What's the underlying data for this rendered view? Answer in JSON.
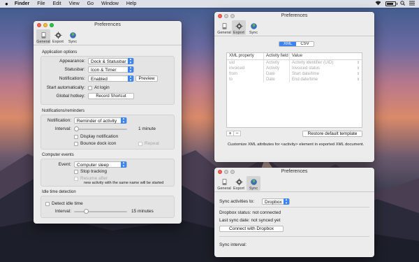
{
  "menubar": {
    "apple": "",
    "items": [
      "Finder",
      "File",
      "Edit",
      "View",
      "Go",
      "Window",
      "Help"
    ]
  },
  "win_general": {
    "title": "Preferences",
    "tabs": [
      "General",
      "Export",
      "Sync"
    ],
    "app_options_title": "Application options",
    "appearance_label": "Appearance:",
    "appearance_value": "Dock & Statusbar",
    "statusbar_label": "Statusbar:",
    "statusbar_value": "Icon & Timer",
    "notifications_label": "Notifications:",
    "notifications_value": "Enabled",
    "preview_button": "Preview",
    "start_auto_label": "Start automatically:",
    "start_auto_check": "At login",
    "hotkey_label": "Global hotkey:",
    "hotkey_button": "Record Shortcut",
    "reminders_title": "Notifications/reminders",
    "notification_label": "Notification:",
    "notification_value": "Reminder of activity",
    "interval_label": "Interval:",
    "interval_value": "1 minute",
    "display_notification": "Display notification",
    "bounce_dock": "Bounce dock icon",
    "repeat": "Repeat",
    "computer_events_title": "Computer events",
    "event_label": "Event:",
    "event_value": "Computer sleep",
    "stop_tracking": "Stop tracking",
    "resume_after": "Resume after",
    "resume_note": "new activity with the same name will be started",
    "idle_title": "Idle time detection",
    "detect_idle": "Detect idle time",
    "idle_interval_label": "Interval:",
    "idle_interval_value": "15 minutes"
  },
  "win_export": {
    "title": "Preferences",
    "tabs": [
      "General",
      "Export",
      "Sync"
    ],
    "formats": [
      "XML",
      "CSV"
    ],
    "columns": [
      "XML property",
      "Activity field",
      "Value"
    ],
    "rows": [
      {
        "prop": "uid",
        "field": "Activity",
        "value": "Activity identifier (UID)"
      },
      {
        "prop": "invoiced",
        "field": "Activity",
        "value": "Invoiced status"
      },
      {
        "prop": "from",
        "field": "Date",
        "value": "Start date/time"
      },
      {
        "prop": "to",
        "field": "Date",
        "value": "End date/time"
      }
    ],
    "add": "+",
    "remove": "−",
    "restore_button": "Restore default template",
    "caption": "Customize XML attributes for <activity> element in exported XML document."
  },
  "win_sync": {
    "title": "Preferences",
    "tabs": [
      "General",
      "Export",
      "Sync"
    ],
    "sync_label": "Sync activities to:",
    "sync_value": "Dropbox",
    "dropbox_status": "Dropbox status: not connected",
    "last_sync": "Last sync date: not synced yet",
    "connect_button": "Connect with Dropbox",
    "sync_interval": "Sync interval:"
  },
  "colors": {
    "accent": "#3b84f2",
    "window_bg": "#ececec"
  }
}
